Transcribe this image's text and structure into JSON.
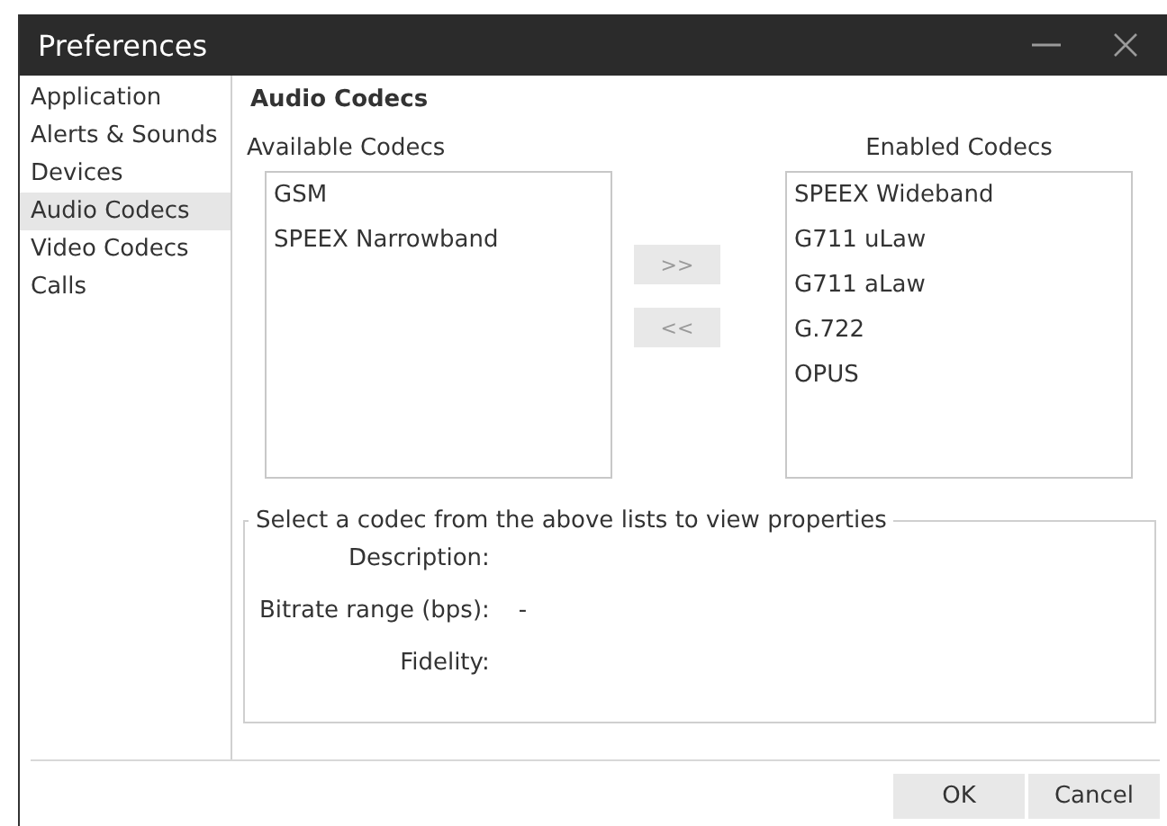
{
  "window": {
    "title": "Preferences"
  },
  "sidebar": {
    "items": [
      {
        "label": "Application",
        "selected": false
      },
      {
        "label": "Alerts & Sounds",
        "selected": false
      },
      {
        "label": "Devices",
        "selected": false
      },
      {
        "label": "Audio Codecs",
        "selected": true
      },
      {
        "label": "Video Codecs",
        "selected": false
      },
      {
        "label": "Calls",
        "selected": false
      }
    ]
  },
  "section_title": "Audio Codecs",
  "available": {
    "label": "Available Codecs",
    "items": [
      "GSM",
      "SPEEX Narrowband"
    ]
  },
  "move_buttons": [
    {
      "label": ">>",
      "disabled": true
    },
    {
      "label": "<<",
      "disabled": true
    }
  ],
  "enabled": {
    "label": "Enabled Codecs",
    "items": [
      "SPEEX Wideband",
      "G711 uLaw",
      "G711 aLaw",
      "G.722",
      "OPUS"
    ]
  },
  "properties": {
    "legend": "Select a codec from the above lists to view properties",
    "fields": [
      {
        "label": "Description:"
      },
      {
        "label": "Bitrate range (bps):",
        "value": "-"
      },
      {
        "label": "Fidelity:"
      }
    ]
  },
  "buttons": [
    "OK",
    "Cancel"
  ]
}
